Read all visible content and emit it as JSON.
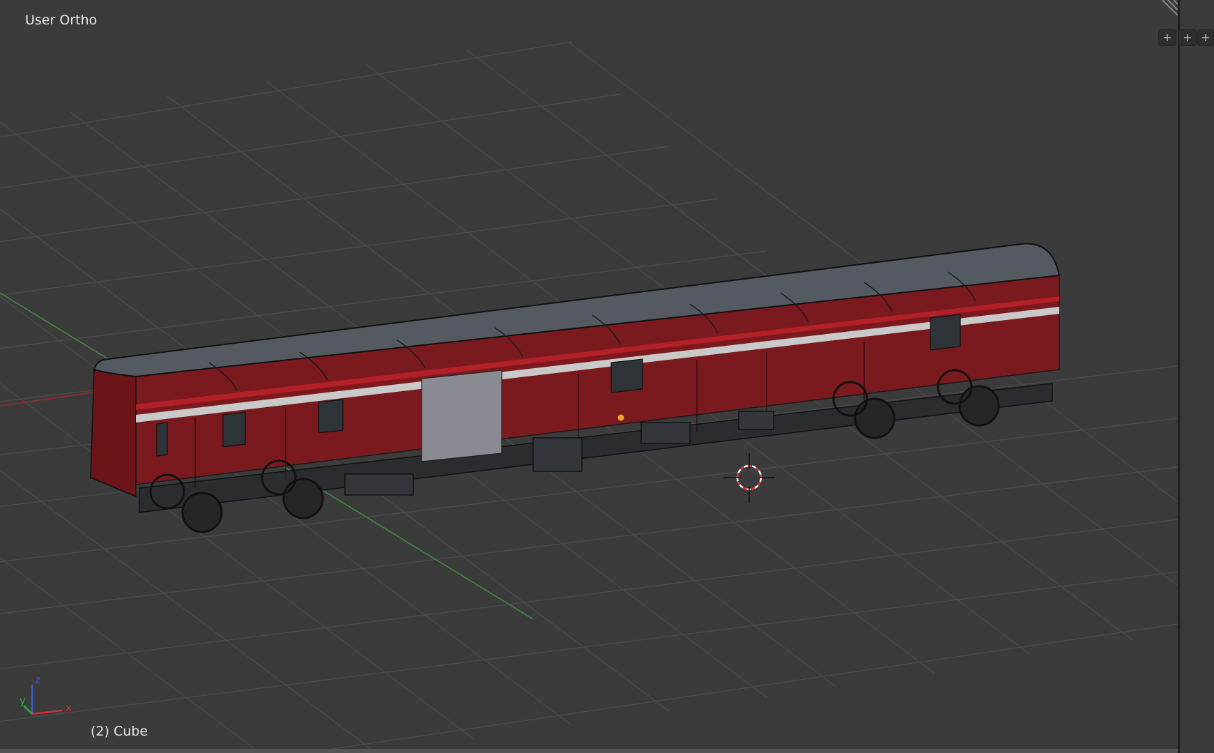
{
  "viewport": {
    "view_label": "User Ortho",
    "object_label": "(2) Cube"
  },
  "axes_gizmo": {
    "x": "x",
    "y": "y",
    "z": "z"
  },
  "header_buttons": [
    {
      "icon": "plus-icon",
      "glyph": "+"
    },
    {
      "icon": "plus-icon",
      "glyph": "+"
    },
    {
      "icon": "plus-icon",
      "glyph": "+"
    }
  ],
  "colors": {
    "background": "#3b3b3b",
    "grid": "#4a4a4a",
    "x_axis": "#9a2a2a",
    "y_axis": "#3f8a3f",
    "body_red": "#7a1a1e",
    "roof": "#555a62"
  }
}
